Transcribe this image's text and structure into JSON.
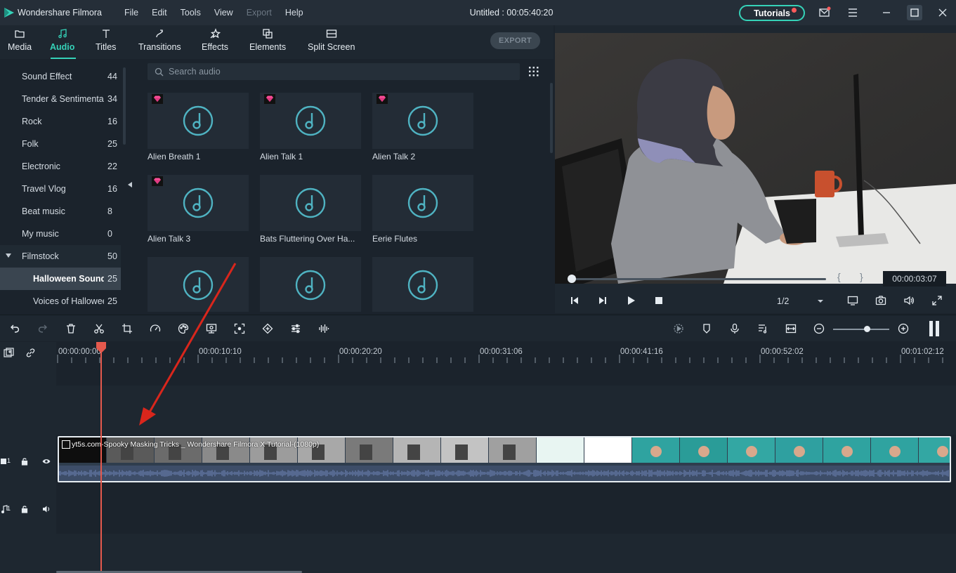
{
  "app": {
    "name": "Wondershare Filmora",
    "document_title": "Untitled : 00:05:40:20",
    "tutorials_label": "Tutorials",
    "accent": "#35d2b8"
  },
  "menu": [
    "File",
    "Edit",
    "Tools",
    "View",
    "Export",
    "Help"
  ],
  "tabs": [
    {
      "label": "Media",
      "icon": "folder-icon"
    },
    {
      "label": "Audio",
      "icon": "music-note-icon",
      "active": true
    },
    {
      "label": "Titles",
      "icon": "text-icon"
    },
    {
      "label": "Transitions",
      "icon": "transitions-icon"
    },
    {
      "label": "Effects",
      "icon": "effects-icon"
    },
    {
      "label": "Elements",
      "icon": "elements-icon"
    },
    {
      "label": "Split Screen",
      "icon": "split-screen-icon"
    }
  ],
  "export_label": "EXPORT",
  "categories": [
    {
      "name": "Sound Effect",
      "count": "44"
    },
    {
      "name": "Tender & Sentimental",
      "count": "34"
    },
    {
      "name": "Rock",
      "count": "16"
    },
    {
      "name": "Folk",
      "count": "25"
    },
    {
      "name": "Electronic",
      "count": "22"
    },
    {
      "name": "Travel Vlog",
      "count": "16"
    },
    {
      "name": "Beat music",
      "count": "8"
    },
    {
      "name": "My music",
      "count": "0"
    },
    {
      "name": "Filmstock",
      "count": "50"
    },
    {
      "name": "Halloween Sounds",
      "count": "25"
    },
    {
      "name": "Voices of Halloween",
      "count": "25"
    }
  ],
  "search": {
    "placeholder": "Search audio"
  },
  "audio_items": [
    {
      "label": "Alien Breath 1",
      "premium": true
    },
    {
      "label": "Alien Talk 1",
      "premium": true
    },
    {
      "label": "Alien Talk 2",
      "premium": true
    },
    {
      "label": "Alien Talk 3",
      "premium": true
    },
    {
      "label": "Bats Fluttering Over Ha...",
      "premium": false
    },
    {
      "label": "Eerie Flutes",
      "premium": false
    },
    {
      "label": "",
      "premium": false
    },
    {
      "label": "",
      "premium": false
    },
    {
      "label": "",
      "premium": false
    }
  ],
  "preview": {
    "timecode": "00:00:03:07",
    "quality": "1/2",
    "brace_open": "{",
    "brace_close": "}",
    "progress": 0.01
  },
  "ruler": [
    "00:00:00:00",
    "00:00:10:10",
    "00:00:20:20",
    "00:00:31:06",
    "00:00:41:16",
    "00:00:52:02",
    "00:01:02:12"
  ],
  "tracks": {
    "video_label": "1",
    "audio_label": "1",
    "clip_title": "yt5s.com-Spooky Masking Tricks _ Wondershare Filmora X Tutorial-(1080p)"
  },
  "zoom": {
    "level": 0.6
  }
}
